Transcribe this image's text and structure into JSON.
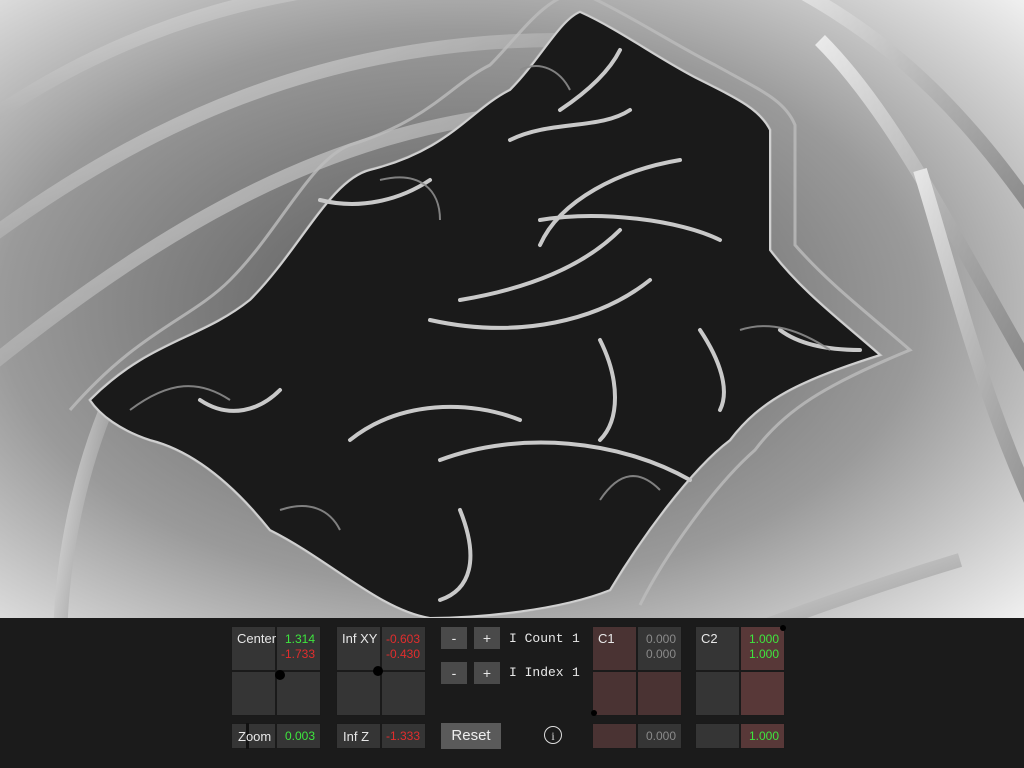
{
  "center": {
    "label": "Center",
    "x": "1.314",
    "y": "-1.733"
  },
  "inf_xy": {
    "label": "Inf XY",
    "x": "-0.603",
    "y": "-0.430"
  },
  "zoom": {
    "label": "Zoom",
    "value": "0.003"
  },
  "inf_z": {
    "label": "Inf Z",
    "value": "-1.333"
  },
  "count": {
    "minus": "-",
    "plus": "+",
    "label": "I Count",
    "value": "1"
  },
  "index": {
    "minus": "-",
    "plus": "+",
    "label": "I Index",
    "value": "1"
  },
  "reset": "Reset",
  "info_icon": "i",
  "c1": {
    "label": "C1",
    "a": "0.000",
    "b": "0.000",
    "slider": "0.000"
  },
  "c2": {
    "label": "C2",
    "a": "1.000",
    "b": "1.000",
    "slider": "1.000"
  },
  "colors": {
    "positive": "#3ee63e",
    "negative": "#e22d2d",
    "c1_tint": "#4a3333",
    "c2_tint": "#583838"
  }
}
